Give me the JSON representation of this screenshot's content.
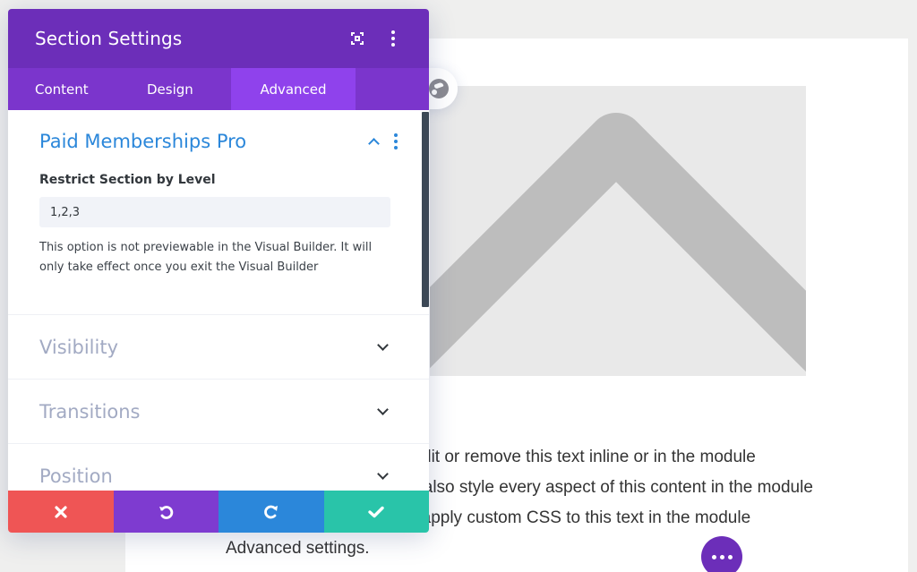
{
  "modal": {
    "title": "Section Settings",
    "header_icons": [
      "expand-icon",
      "more-vertical-icon"
    ],
    "tabs": [
      {
        "label": "Content",
        "active": false
      },
      {
        "label": "Design",
        "active": false
      },
      {
        "label": "Advanced",
        "active": true
      }
    ],
    "open_group": {
      "title": "Paid Memberships Pro",
      "field_label": "Restrict Section by Level",
      "field_value": "1,2,3",
      "help_text": "This option is not previewable in the Visual Builder. It will only take effect once you exit the Visual Builder"
    },
    "closed_groups": [
      {
        "title": "Visibility"
      },
      {
        "title": "Transitions"
      },
      {
        "title": "Position"
      }
    ],
    "footer_buttons": [
      {
        "name": "cancel",
        "icon": "close-icon",
        "color": "#ef5555"
      },
      {
        "name": "undo",
        "icon": "undo-icon",
        "color": "#7e3bd0"
      },
      {
        "name": "redo",
        "icon": "redo-icon",
        "color": "#2b87da"
      },
      {
        "name": "save",
        "icon": "check-icon",
        "color": "#29c4a9"
      }
    ]
  },
  "page": {
    "body_text": "Your content goes here. Edit or remove this text inline or in the module Content settings. You can also style every aspect of this content in the module Design settings and even apply custom CSS to this text in the module Advanced settings."
  },
  "colors": {
    "header_purple": "#6c2eb9",
    "tab_purple": "#7b35cc",
    "active_tab": "#8f42ec",
    "accent_blue": "#2b87da"
  }
}
